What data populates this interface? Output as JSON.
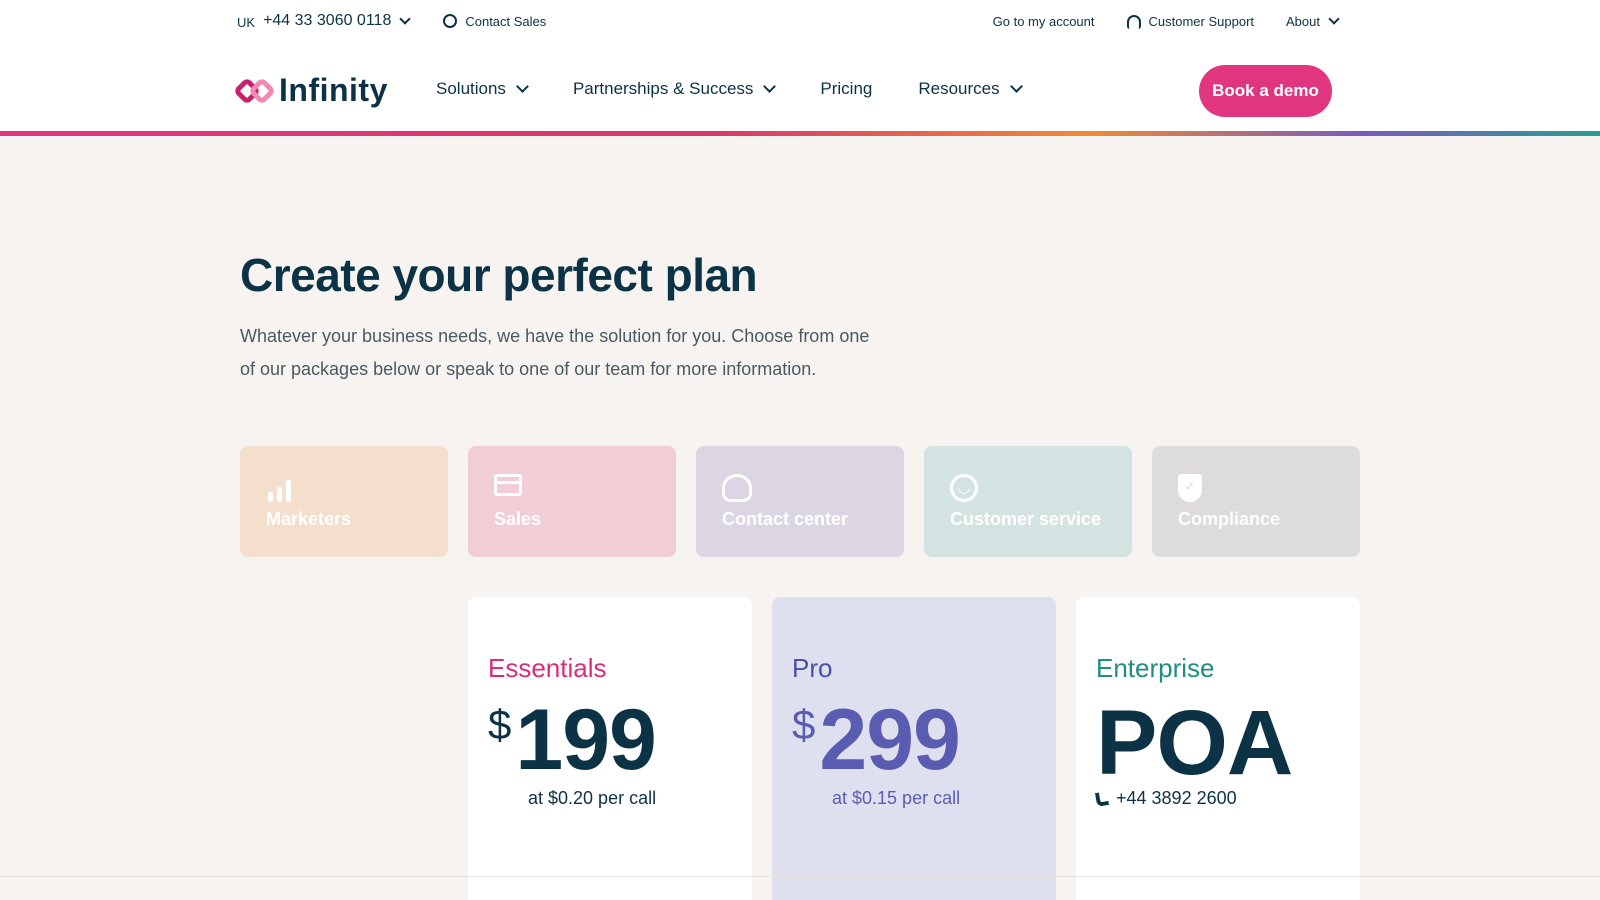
{
  "topbar": {
    "region": "UK",
    "phone": "+44 33 3060 0118",
    "contact_sales": "Contact Sales",
    "account": "Go to my account",
    "support": "Customer Support",
    "about": "About"
  },
  "nav": {
    "logo": "Infinity",
    "items": [
      "Solutions",
      "Partnerships & Success",
      "Pricing",
      "Resources"
    ],
    "demo": "Book a demo"
  },
  "hero": {
    "title": "Create your perfect plan",
    "text": "Whatever your business needs, we have the solution for you. Choose from one of our packages below or speak to one of our team for more information."
  },
  "categories": [
    {
      "label": "Marketers",
      "icon": "bar-chart-icon"
    },
    {
      "label": "Sales",
      "icon": "credit-card-icon"
    },
    {
      "label": "Contact center",
      "icon": "headset-icon"
    },
    {
      "label": "Customer service",
      "icon": "smile-icon"
    },
    {
      "label": "Compliance",
      "icon": "shield-icon"
    }
  ],
  "plans": [
    {
      "name": "Essentials",
      "currency": "$",
      "price": "199",
      "rate": "at $0.20 per call"
    },
    {
      "name": "Pro",
      "currency": "$",
      "price": "299",
      "rate": "at $0.15 per call"
    },
    {
      "name": "Enterprise",
      "price": "POA",
      "rate": "+44 3892 2600"
    }
  ],
  "colors": {
    "primary": "#e0357f",
    "navy": "#0c3245",
    "pro": "#5a5cb2",
    "enterprise": "#1f8d80"
  }
}
